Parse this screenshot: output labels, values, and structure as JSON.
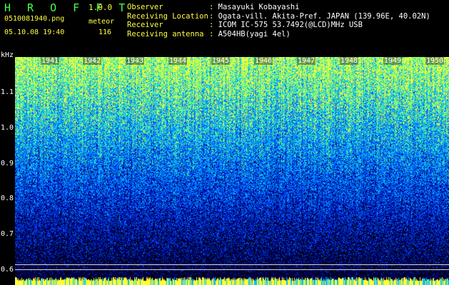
{
  "app": {
    "title": "H R O F F T",
    "version": "1.0.0",
    "filename": "0510081940.png",
    "mode": "meteor",
    "datetime": "05.10.08 19:40",
    "count": "116"
  },
  "info": [
    {
      "label": "Observer",
      "sep": ":",
      "value": "Masayuki Kobayashi"
    },
    {
      "label": "Receiving Location",
      "sep": ":",
      "value": "Ogata-vill. Akita-Pref. JAPAN (139.96E, 40.02N)"
    },
    {
      "label": "Receiver",
      "sep": ":",
      "value": "ICOM IC-575 53.7492(@LCD)MHz USB"
    },
    {
      "label": "Receiving antenna",
      "sep": ":",
      "value": "A504HB(yagi 4el)"
    }
  ],
  "spectrogram": {
    "y_unit": "kHz",
    "y_ticks": [
      "1.1",
      "1.0",
      "0.9",
      "0.8",
      "0.7",
      "0.6"
    ],
    "x_ticks": [
      "1941",
      "1942",
      "1943",
      "1944",
      "1945",
      "1946",
      "1947",
      "1948",
      "1949",
      "1950"
    ],
    "colors": {
      "low": "#00007f",
      "mid": "#0050ff",
      "high": "#00c0ff",
      "peak": "#60ff80",
      "hot": "#ffff30",
      "grid": "#d8d8d8"
    }
  }
}
